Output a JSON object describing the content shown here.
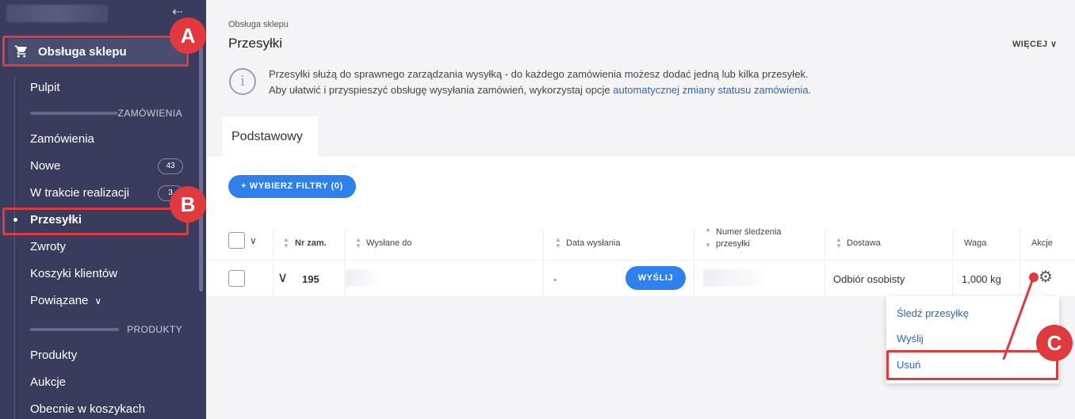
{
  "sidebar": {
    "section_label": "Obsługa sklepu",
    "items": {
      "pulpit": "Pulpit",
      "group_orders": "ZAMÓWIENIA",
      "zamowienia": "Zamówienia",
      "nowe": "Nowe",
      "nowe_count": "43",
      "w_trakcie": "W trakcie realizacji",
      "w_trakcie_count": "3",
      "przesylki": "Przesyłki",
      "zwroty": "Zwroty",
      "koszyki": "Koszyki klientów",
      "powiazane": "Powiązane",
      "group_products": "PRODUKTY",
      "produkty": "Produkty",
      "aukcje": "Aukcje",
      "obecnie": "Obecnie w koszykach"
    }
  },
  "header": {
    "breadcrumb": "Obsługa sklepu",
    "title": "Przesyłki",
    "more_label": "WIĘCEJ"
  },
  "info": {
    "line1": "Przesyłki służą do sprawnego zarządzania wysyłką - do każdego zamówienia możesz dodać jedną lub kilka przesyłek.",
    "line2_prefix": "Aby ułatwić i przyspieszyć obsługę wysyłania zamówień, wykorzystaj opcje ",
    "line2_link": "automatycznej zmiany statusu zamówienia",
    "line2_suffix": "."
  },
  "tabs": {
    "basic": "Podstawowy"
  },
  "filters": {
    "button_label": "+ WYBIERZ FILTRY (0)"
  },
  "table": {
    "headers": {
      "order_no": "Nr zam.",
      "sent_to": "Wysłane do",
      "send_date": "Data wysłania",
      "tracking_1": "Numer śledzenia",
      "tracking_2": "przesyłki",
      "delivery": "Dostawa",
      "weight": "Waga",
      "actions": "Akcje"
    },
    "row": {
      "order_no": "195",
      "send_date": "-",
      "send_button": "WYŚLIJ",
      "delivery": "Odbiór osobisty",
      "weight": "1,000 kg"
    }
  },
  "dropdown": {
    "track": "Śledź przesyłkę",
    "send": "Wyślij",
    "delete": "Usuń"
  },
  "annotations": {
    "a": "A",
    "b": "B",
    "c": "C"
  },
  "colors": {
    "sidebar": "#3a3c5e",
    "accent": "#2f80ed",
    "annotation": "#e0393e"
  }
}
